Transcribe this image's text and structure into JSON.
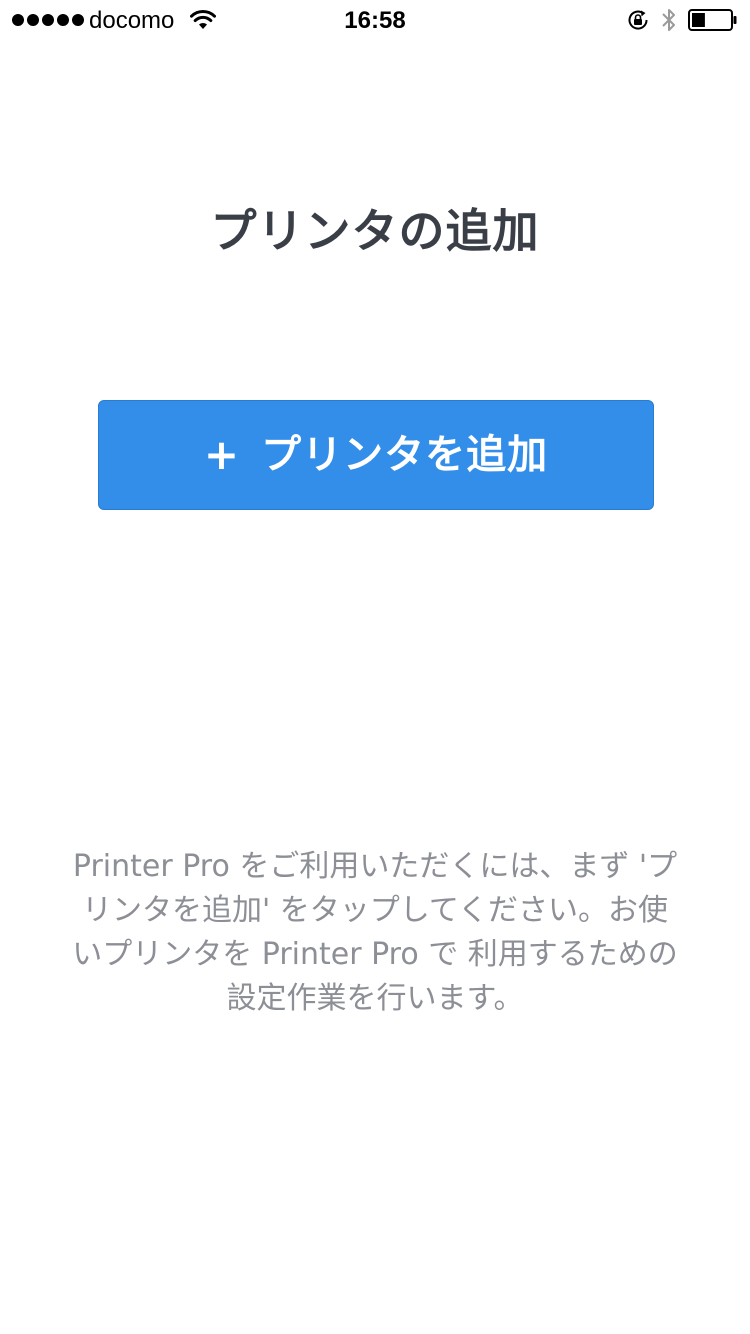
{
  "status_bar": {
    "carrier": "docomo",
    "time": "16:58",
    "signal_icon": "signal-dots-icon",
    "wifi_icon": "wifi-icon",
    "rotation_lock_icon": "rotation-lock-icon",
    "bluetooth_icon": "bluetooth-icon",
    "battery_icon": "battery-icon",
    "battery_level": 0.35
  },
  "main": {
    "title": "プリンタの追加",
    "add_button": {
      "icon": "plus-icon",
      "plus": "+",
      "label": "プリンタを追加",
      "color": "#338ee9"
    },
    "description_lines": [
      "Printer Pro をご利用いただくには、まず 'プ",
      "リンタを追加' をタップしてください。お使",
      "いプリンタを Printer Pro で 利用するための",
      "設定作業を行います。"
    ]
  }
}
